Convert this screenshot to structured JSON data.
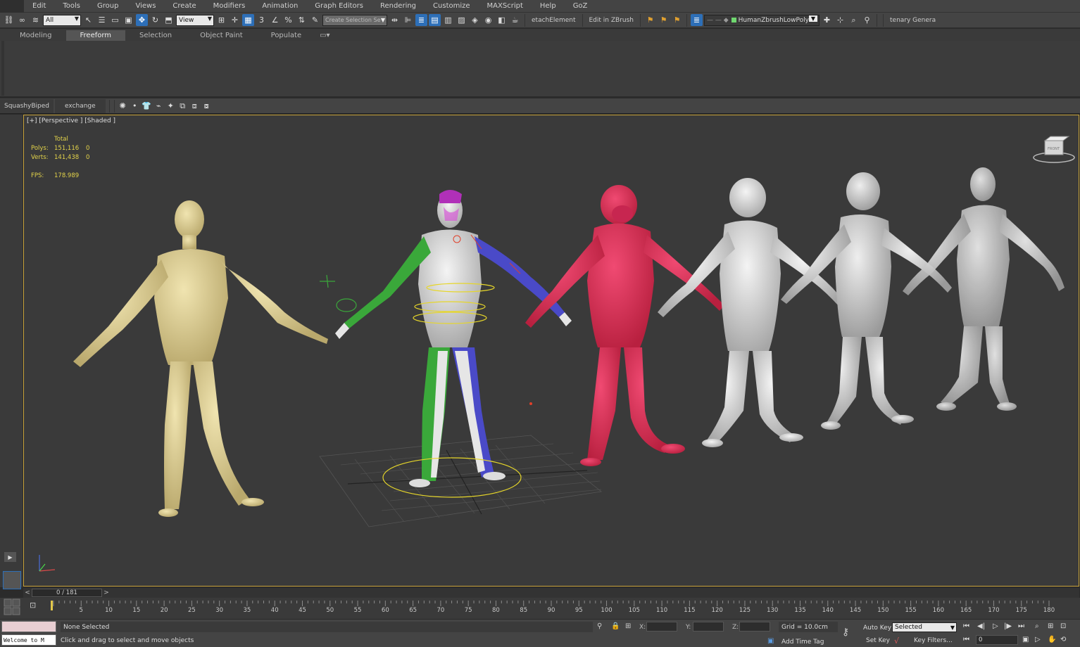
{
  "menubar": {
    "items": [
      "Edit",
      "Tools",
      "Group",
      "Views",
      "Create",
      "Modifiers",
      "Animation",
      "Graph Editors",
      "Rendering",
      "Customize",
      "MAXScript",
      "Help",
      "GoZ"
    ]
  },
  "main_toolbar": {
    "selection_filter": "All",
    "reference_coord": "View",
    "named_selection_placeholder": "Create Selection Se",
    "detach_element": "etachElement",
    "edit_in_zbrush": "Edit in ZBrush",
    "layer_name": "HumanZbrushLowPoly",
    "catenary": "tenary Genera"
  },
  "ribbon": {
    "tabs": [
      "Modeling",
      "Freeform",
      "Selection",
      "Object Paint",
      "Populate"
    ],
    "active_tab": "Freeform"
  },
  "shelf": {
    "tabs": [
      "SquashyBiped",
      "exchange"
    ]
  },
  "viewport": {
    "label": "[+] [Perspective ] [Shaded ]",
    "stats": {
      "header": "Total",
      "polys_label": "Polys:",
      "polys_value": "151,116",
      "polys_sel": "0",
      "verts_label": "Verts:",
      "verts_value": "141,438",
      "verts_sel": "0",
      "fps_label": "FPS:",
      "fps_value": "178.989"
    },
    "viewcube_label": "FRONT",
    "colors": {
      "human_mesh": "#e2d39a",
      "rigged_mesh": "#d6d6d6",
      "left_limb": "#3aa83a",
      "right_limb": "#4a4ac8",
      "chimp_selected": "#e2325a",
      "chimp_grey": "#cfcfcf",
      "rig_gizmo": "#e6d62a"
    }
  },
  "time_slider": {
    "prev": "<",
    "next": ">",
    "position": "0 / 181"
  },
  "timeline": {
    "ticks": [
      5,
      10,
      15,
      20,
      25,
      30,
      35,
      40,
      45,
      50,
      55,
      60,
      65,
      70,
      75,
      80,
      85,
      90,
      95,
      100,
      105,
      110,
      115,
      120,
      125,
      130,
      135,
      140,
      145,
      150,
      155,
      160,
      165,
      170,
      175,
      180
    ]
  },
  "statusbar": {
    "maxscript_text": "Welcome to M",
    "selection_status": "None Selected",
    "prompt": "Click and drag to select and move objects",
    "x_label": "X:",
    "y_label": "Y:",
    "z_label": "Z:",
    "grid": "Grid = 10.0cm",
    "add_time_tag": "Add Time Tag",
    "auto_key": "Auto Key",
    "set_key": "Set Key",
    "key_mode": "Selected",
    "key_filters": "Key Filters...",
    "current_frame": "0"
  }
}
